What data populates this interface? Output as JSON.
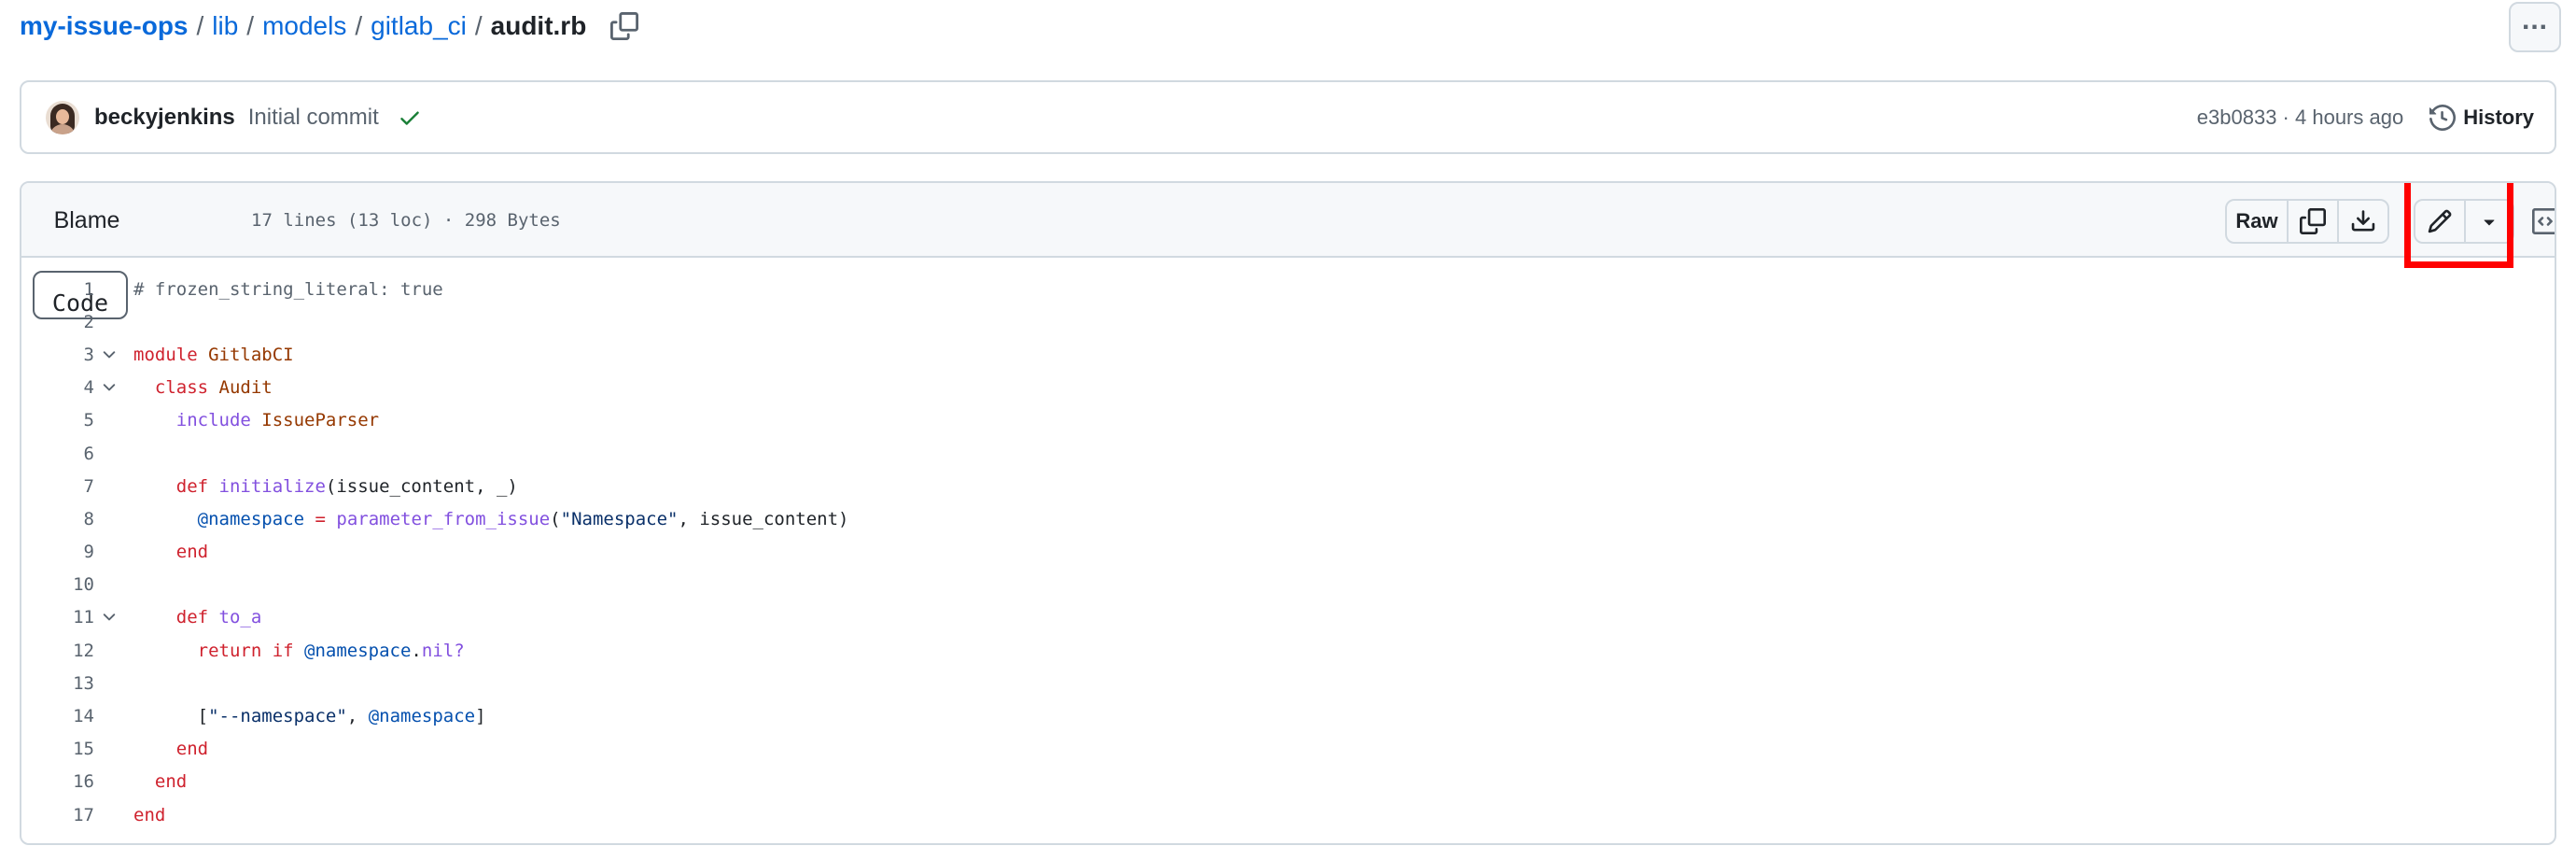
{
  "breadcrumb": {
    "repo": "my-issue-ops",
    "dirs": [
      "lib",
      "models",
      "gitlab_ci"
    ],
    "file": "audit.rb",
    "separator": "/"
  },
  "commit": {
    "author": "beckyjenkins",
    "message": "Initial commit",
    "sha_time": "e3b0833 · 4 hours ago",
    "history_label": "History"
  },
  "file_header": {
    "tabs": [
      "Code",
      "Blame"
    ],
    "active_tab": "Code",
    "meta": "17 lines (13 loc) · 298 Bytes",
    "raw_label": "Raw"
  },
  "code": {
    "lines": [
      {
        "n": "1",
        "fold": false,
        "tokens": [
          [
            "c",
            "# frozen_string_literal: true"
          ]
        ]
      },
      {
        "n": "2",
        "fold": false,
        "tokens": []
      },
      {
        "n": "3",
        "fold": true,
        "tokens": [
          [
            "k",
            "module "
          ],
          [
            "t",
            "GitlabCI"
          ]
        ]
      },
      {
        "n": "4",
        "fold": true,
        "tokens": [
          [
            "p",
            "  "
          ],
          [
            "k",
            "class "
          ],
          [
            "t",
            "Audit"
          ]
        ]
      },
      {
        "n": "5",
        "fold": false,
        "tokens": [
          [
            "p",
            "    "
          ],
          [
            "f",
            "include "
          ],
          [
            "t",
            "IssueParser"
          ]
        ]
      },
      {
        "n": "6",
        "fold": false,
        "tokens": []
      },
      {
        "n": "7",
        "fold": false,
        "tokens": [
          [
            "p",
            "    "
          ],
          [
            "k",
            "def "
          ],
          [
            "f",
            "initialize"
          ],
          [
            "p",
            "(issue_content, _)"
          ]
        ]
      },
      {
        "n": "8",
        "fold": false,
        "tokens": [
          [
            "p",
            "      "
          ],
          [
            "v",
            "@namespace"
          ],
          [
            "p",
            " "
          ],
          [
            "k",
            "="
          ],
          [
            "p",
            " "
          ],
          [
            "f",
            "parameter_from_issue"
          ],
          [
            "p",
            "("
          ],
          [
            "s",
            "\"Namespace\""
          ],
          [
            "p",
            ", issue_content)"
          ]
        ]
      },
      {
        "n": "9",
        "fold": false,
        "tokens": [
          [
            "p",
            "    "
          ],
          [
            "k",
            "end"
          ]
        ]
      },
      {
        "n": "10",
        "fold": false,
        "tokens": []
      },
      {
        "n": "11",
        "fold": true,
        "tokens": [
          [
            "p",
            "    "
          ],
          [
            "k",
            "def "
          ],
          [
            "f",
            "to_a"
          ]
        ]
      },
      {
        "n": "12",
        "fold": false,
        "tokens": [
          [
            "p",
            "      "
          ],
          [
            "k",
            "return if "
          ],
          [
            "v",
            "@namespace"
          ],
          [
            "p",
            "."
          ],
          [
            "f",
            "nil?"
          ]
        ]
      },
      {
        "n": "13",
        "fold": false,
        "tokens": []
      },
      {
        "n": "14",
        "fold": false,
        "tokens": [
          [
            "p",
            "      ["
          ],
          [
            "s",
            "\"--namespace\""
          ],
          [
            "p",
            ", "
          ],
          [
            "v",
            "@namespace"
          ],
          [
            "p",
            "]"
          ]
        ]
      },
      {
        "n": "15",
        "fold": false,
        "tokens": [
          [
            "p",
            "    "
          ],
          [
            "k",
            "end"
          ]
        ]
      },
      {
        "n": "16",
        "fold": false,
        "tokens": [
          [
            "p",
            "  "
          ],
          [
            "k",
            "end"
          ]
        ]
      },
      {
        "n": "17",
        "fold": false,
        "tokens": [
          [
            "k",
            "end"
          ]
        ]
      }
    ]
  },
  "icons": {
    "copy_path": "copy-icon",
    "check": "check-icon",
    "history": "history-icon",
    "copy_raw": "copy-icon",
    "download": "download-icon",
    "edit": "pencil-icon",
    "edit_more": "triangle-down-icon",
    "symbols": "code-square-icon",
    "more": "kebab-horizontal-icon",
    "fold": "chevron-down-icon"
  },
  "colors": {
    "link": "#0969da",
    "check": "#1a7f37",
    "highlight": "#ff0000",
    "keyword": "#cf222e",
    "type": "#953800",
    "function": "#8250df",
    "variable": "#0550ae",
    "string": "#0a3069",
    "comment": "#59636e"
  }
}
